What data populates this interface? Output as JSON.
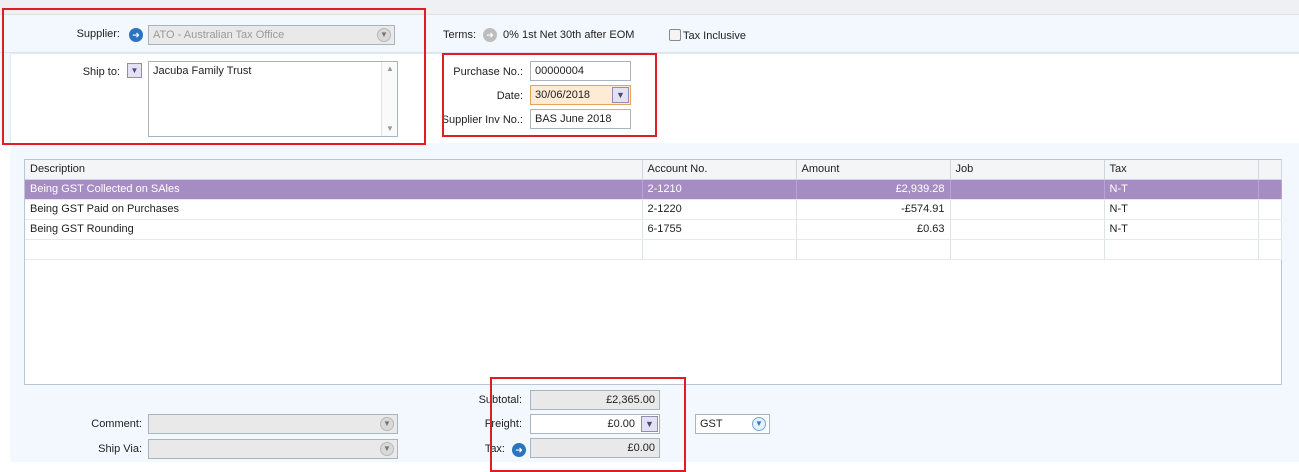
{
  "header": {
    "supplier_label": "Supplier:",
    "supplier_value": "ATO - Australian Tax Office",
    "terms_label": "Terms:",
    "terms_value": "0% 1st Net 30th after EOM",
    "tax_inclusive_label": "Tax Inclusive",
    "ship_to_label": "Ship to:",
    "ship_to_value": "Jacuba Family Trust",
    "purchase_no_label": "Purchase No.:",
    "purchase_no_value": "00000004",
    "date_label": "Date:",
    "date_value": "30/06/2018",
    "supplier_inv_label": "Supplier Inv No.:",
    "supplier_inv_value": "BAS June 2018"
  },
  "grid": {
    "columns": [
      "Description",
      "Account No.",
      "Amount",
      "Job",
      "Tax"
    ],
    "rows": [
      {
        "description": "Being GST Collected on SAles",
        "account": "2-1210",
        "amount": "£2,939.28",
        "job": "",
        "tax": "N-T"
      },
      {
        "description": "Being GST Paid on Purchases",
        "account": "2-1220",
        "amount": "-£574.91",
        "job": "",
        "tax": "N-T"
      },
      {
        "description": "Being GST Rounding",
        "account": "6-1755",
        "amount": "£0.63",
        "job": "",
        "tax": "N-T"
      }
    ]
  },
  "footer": {
    "comment_label": "Comment:",
    "ship_via_label": "Ship Via:",
    "subtotal_label": "Subtotal:",
    "subtotal_value": "£2,365.00",
    "freight_label": "Freight:",
    "freight_value": "£0.00",
    "freight_tax_code": "GST",
    "tax_label": "Tax:",
    "tax_value": "£0.00"
  },
  "colors": {
    "selected_row": "#a58cc3",
    "highlight_box": "#e01c24",
    "panel_bg": "#f2f8fd"
  }
}
